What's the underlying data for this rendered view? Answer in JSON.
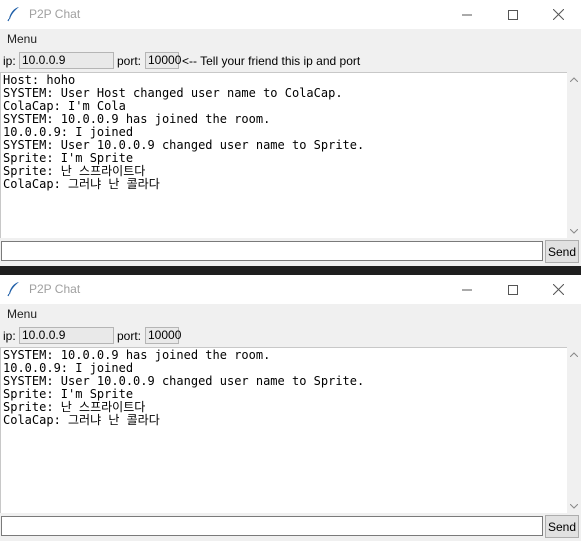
{
  "colors": {
    "titlebar_bg": "#ffffff",
    "window_bg": "#f0f0f0",
    "chat_bg": "#ffffff",
    "divider": "#1e1e1e"
  },
  "windows": [
    {
      "title": "P2P Chat",
      "menu": "Menu",
      "ip_label": "ip:",
      "ip_value": "10.0.0.9",
      "port_label": "port:",
      "port_value": "10000",
      "hint": "<-- Tell your friend this ip and port",
      "send_label": "Send",
      "messages": [
        "Host: hoho",
        "SYSTEM: User Host changed user name to ColaCap.",
        "ColaCap: I'm Cola",
        "SYSTEM: 10.0.0.9 has joined the room.",
        "10.0.0.9: I joined",
        "SYSTEM: User 10.0.0.9 changed user name to Sprite.",
        "Sprite: I'm Sprite",
        "Sprite: 난 스프라이트다",
        "ColaCap: 그러냐 난 콜라다"
      ]
    },
    {
      "title": "P2P Chat",
      "menu": "Menu",
      "ip_label": "ip:",
      "ip_value": "10.0.0.9",
      "port_label": "port:",
      "port_value": "10000",
      "hint": "",
      "send_label": "Send",
      "messages": [
        "SYSTEM: 10.0.0.9 has joined the room.",
        "10.0.0.9: I joined",
        "SYSTEM: User 10.0.0.9 changed user name to Sprite.",
        "Sprite: I'm Sprite",
        "Sprite: 난 스프라이트다",
        "ColaCap: 그러냐 난 콜라다"
      ]
    }
  ]
}
